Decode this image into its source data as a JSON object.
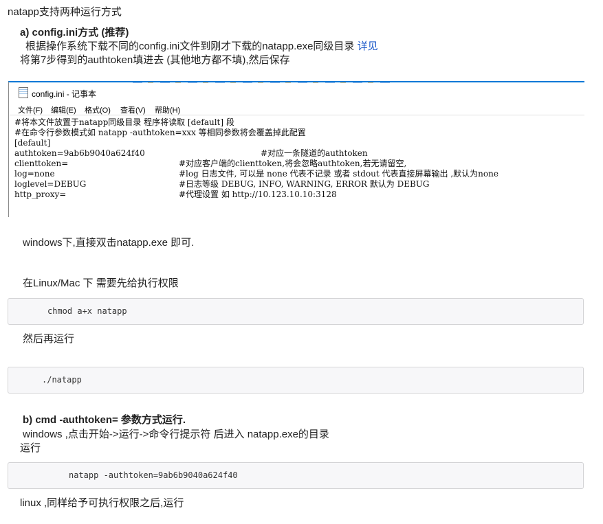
{
  "heading": "natapp支持两种运行方式",
  "section_a": {
    "title": "a) config.ini方式 (推荐)",
    "line1": "根据操作系统下载不同的config.ini文件到刚才下载的natapp.exe同级目录",
    "line1_link": "详见",
    "line2": "将第7步得到的authtoken填进去 (其他地方都不填),然后保存"
  },
  "notepad": {
    "title": "config.ini - 记事本",
    "menus": [
      "文件(F)",
      "编辑(E)",
      "格式(O)",
      "查看(V)",
      "帮助(H)"
    ],
    "lines": [
      "#将本文件放置于natapp同级目录 程序将读取 [default] 段",
      "#在命令行参数模式如 natapp -authtoken=xxx 等相同参数将会覆盖掉此配置",
      "[default]"
    ],
    "settings": [
      {
        "key": "authtoken=9ab6b9040a624f40",
        "comment": "#对应一条隧道的authtoken"
      },
      {
        "key": "clienttoken=",
        "comment": "#对应客户端的clienttoken,将会忽略authtoken,若无请留空,"
      },
      {
        "key": "log=none",
        "comment": "#log 日志文件, 可以是 none 代表不记录 或者 stdout 代表直接屏幕输出 ,默认为none"
      },
      {
        "key": "loglevel=DEBUG",
        "comment": "#日志等级 DEBUG, INFO, WARNING, ERROR 默认为 DEBUG"
      },
      {
        "key": "http_proxy=",
        "comment": "#代理设置 如 http://10.123.10.10:3128"
      }
    ]
  },
  "windows_run": "windows下,直接双击natapp.exe 即可.",
  "linux_perm": "在Linux/Mac 下 需要先给执行权限",
  "code_chmod": "chmod a+x natapp",
  "then_run": "然后再运行",
  "code_run": "./natapp",
  "section_b": {
    "title": "b) cmd -authtoken= 参数方式运行.",
    "line1": "windows ,点击开始->运行->命令行提示符 后进入 natapp.exe的目录",
    "line2": "运行"
  },
  "code_auth": "natapp -authtoken=9ab6b9040a624f40",
  "linux_after": "linux ,同样给予可执行权限之后,运行"
}
